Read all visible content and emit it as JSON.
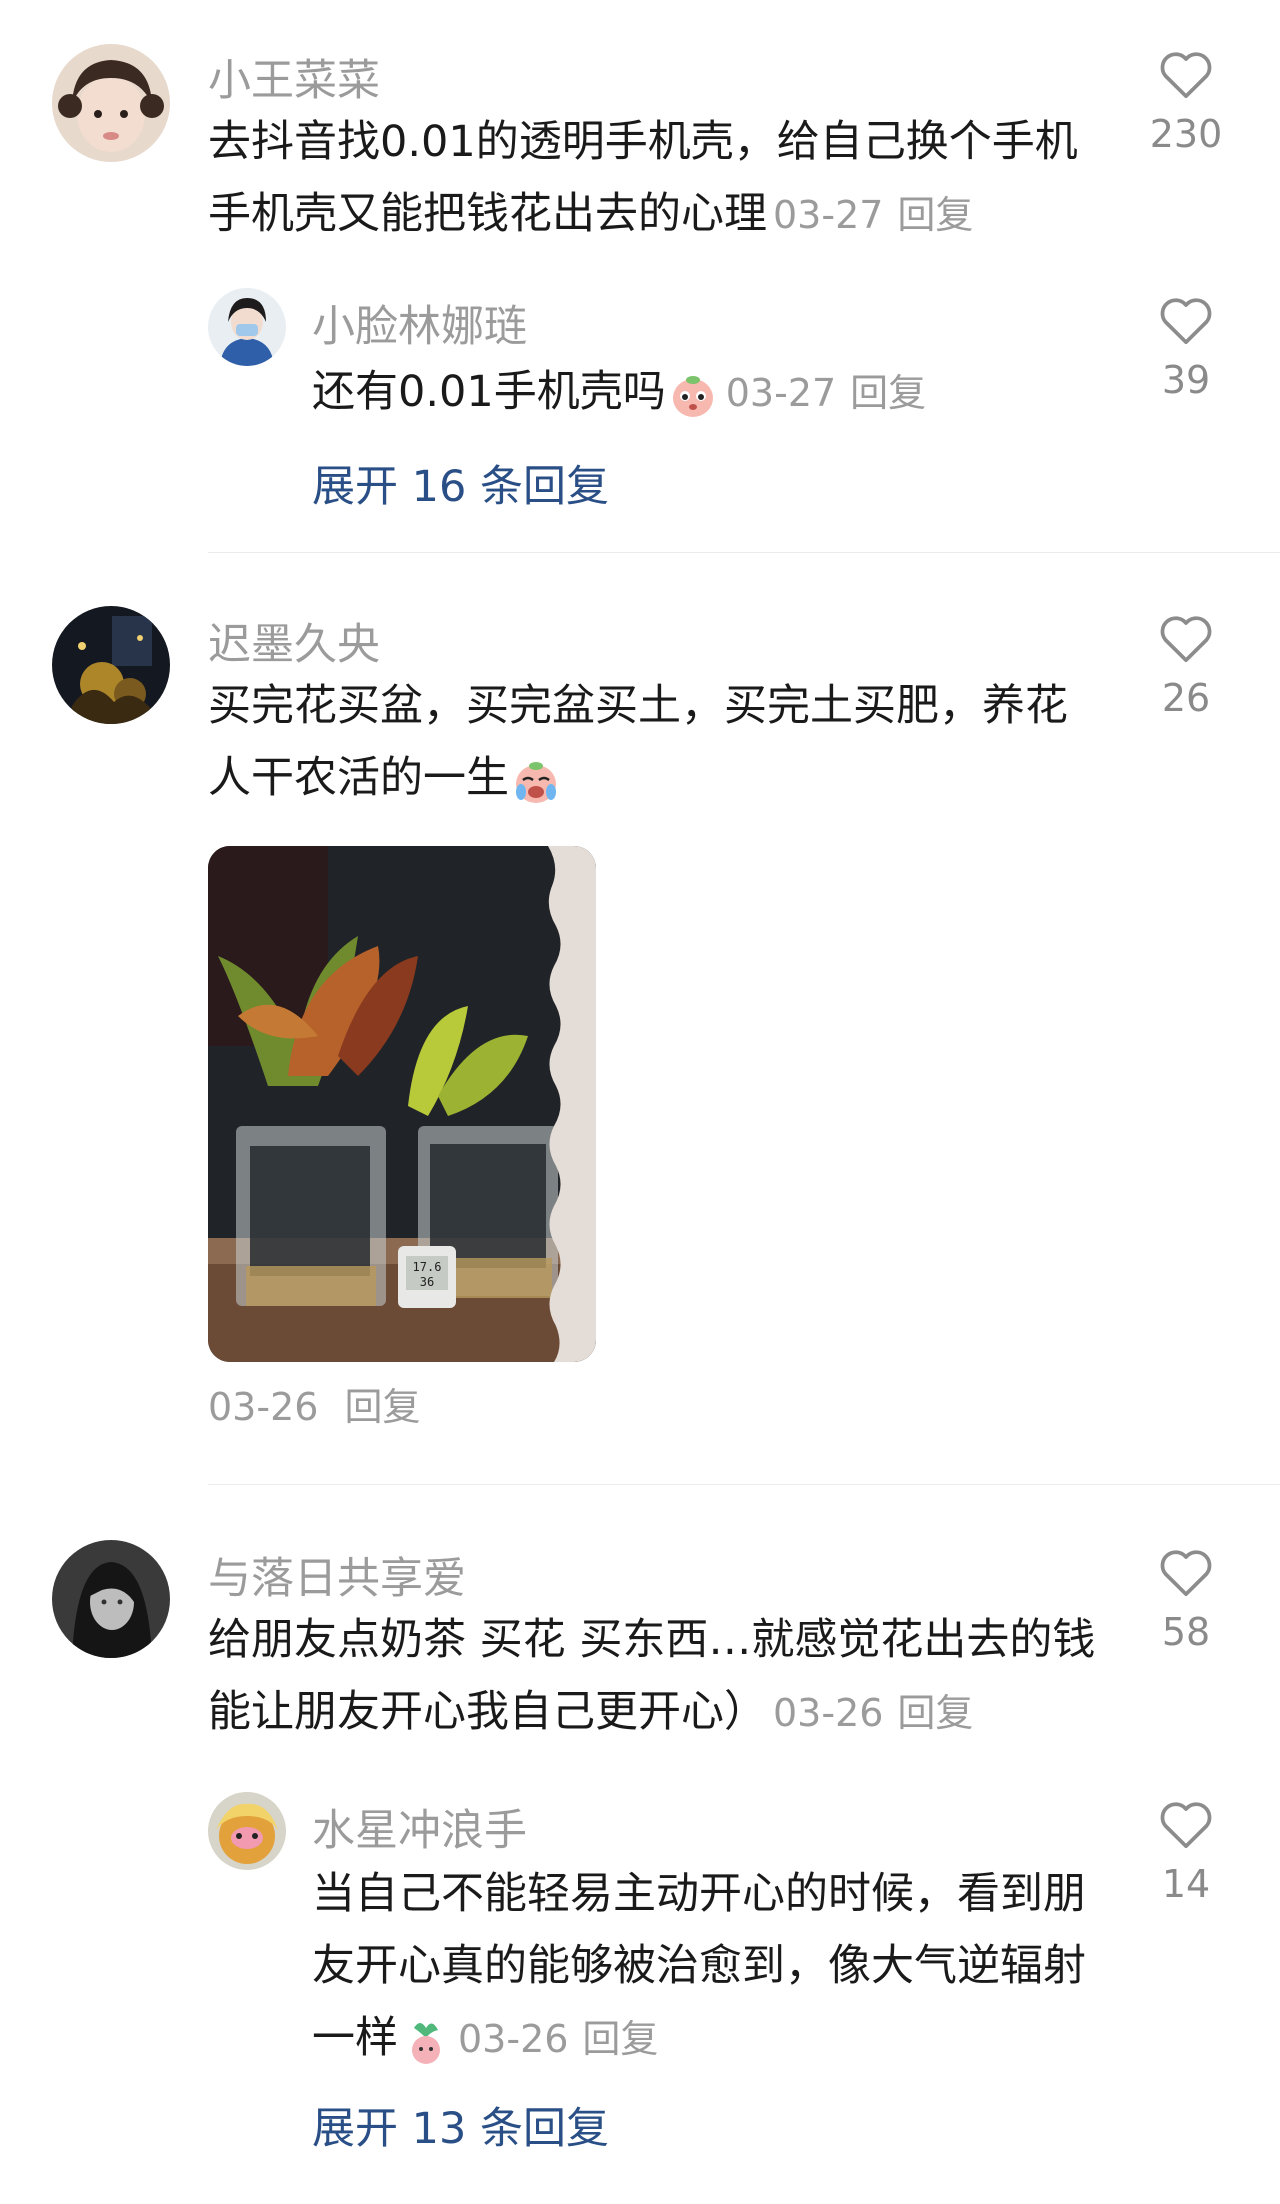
{
  "comments": [
    {
      "name": "小王菜菜",
      "text": "去抖音找0.01的透明手机壳，给自己换个手机手机壳又能把钱花出去的心理",
      "date": "03-27",
      "reply": "回复",
      "likes": "230"
    },
    {
      "name": "迟墨久央",
      "text": "买完花买盆，买完盆买土，买完土买肥，养花人干农活的一生",
      "date": "03-26",
      "reply": "回复",
      "likes": "26"
    },
    {
      "name": "与落日共享爱",
      "text": "给朋友点奶茶 买花 买东西…就感觉花出去的钱能让朋友开心我自己更开心）",
      "date": "03-26",
      "reply": "回复",
      "likes": "58"
    }
  ],
  "replies": [
    {
      "name": "小脸林娜琏",
      "text": "还有0.01手机壳吗",
      "date": "03-27",
      "reply": "回复",
      "likes": "39",
      "expand": "展开 16 条回复"
    },
    {
      "name": "水星冲浪手",
      "text": "当自己不能轻易主动开心的时候，看到朋友开心真的能够被治愈到，像大气逆辐射一样",
      "date": "03-26",
      "reply": "回复",
      "likes": "14",
      "expand": "展开 13 条回复"
    }
  ],
  "thermometer": {
    "temp": "17.6",
    "humidity": "36"
  },
  "colors": {
    "name": "#9b9b9b",
    "expand": "#2a4f86",
    "heart": "#8c8c8c"
  }
}
